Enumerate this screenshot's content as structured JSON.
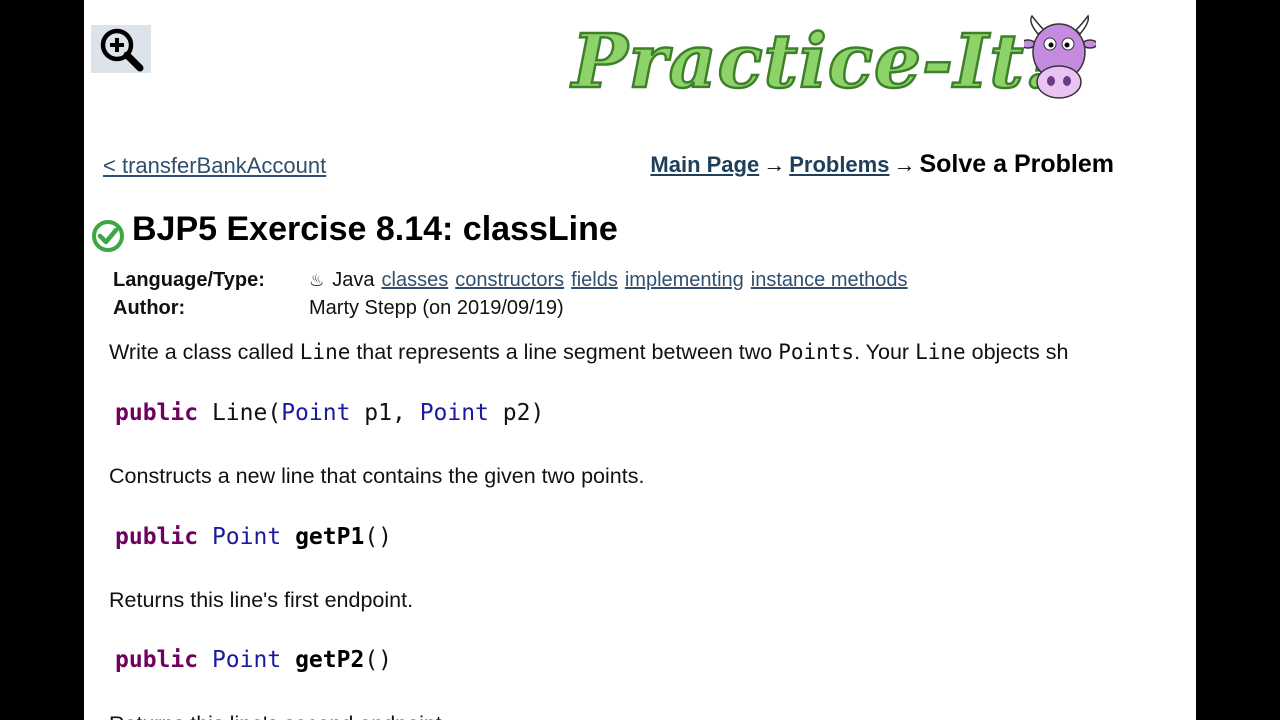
{
  "header": {
    "logo_text": "Practice-It!",
    "prev_link": "< transferBankAccount",
    "breadcrumb": {
      "main_page": "Main Page",
      "problems": "Problems",
      "arrow": "→",
      "current": "Solve a Problem"
    }
  },
  "problem": {
    "title": "BJP5 Exercise 8.14: classLine",
    "language_label": "Language/Type:",
    "language": "Java",
    "tags": [
      "classes",
      "constructors",
      "fields",
      "implementing",
      "instance methods"
    ],
    "author_label": "Author:",
    "author": "Marty Stepp (on 2019/09/19)"
  },
  "description": {
    "intro_parts": [
      "Write a class called ",
      "Line",
      " that represents a line segment between two ",
      "Points",
      ". Your ",
      "Line",
      " objects sh"
    ],
    "constructor": {
      "kw": "public",
      "name": "Line(",
      "t1": "Point",
      "a1": " p1, ",
      "t2": "Point",
      "a2": " p2)"
    },
    "constructor_desc": "Constructs a new line that contains the given two points.",
    "method1": {
      "kw": "public",
      "type": "Point",
      "name": "getP1",
      "parens": "()"
    },
    "method1_desc": "Returns this line's first endpoint.",
    "method2": {
      "kw": "public",
      "type": "Point",
      "name": "getP2",
      "parens": "()"
    },
    "method2_desc": "Returns this line's second endpoint."
  },
  "colors": {
    "link": "#2f4f6e",
    "keyword": "#700060",
    "type": "#1a1aa0",
    "solved": "#3aa844"
  }
}
